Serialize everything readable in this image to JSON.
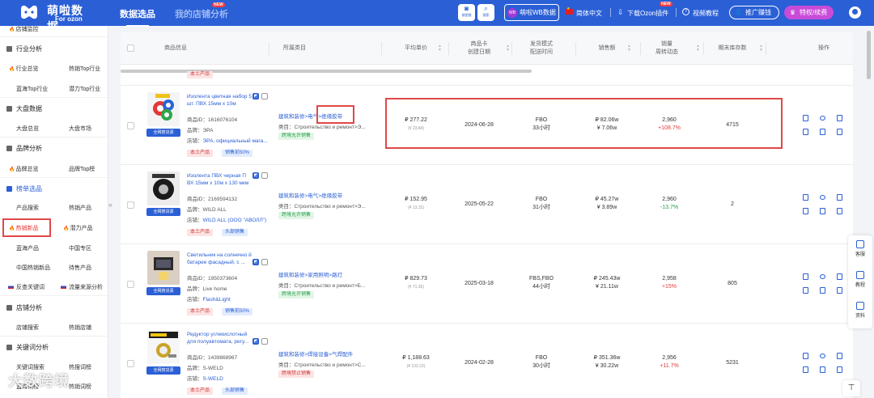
{
  "brand": {
    "name": "萌啦数据",
    "sub": "For ozon"
  },
  "nav": {
    "tab_selection": "数据选品",
    "tab_store": "我的店铺分析",
    "store_badge": "NEW"
  },
  "topbar": {
    "screenshot_label": "按图搜",
    "search_label": "搜索",
    "wb_label": "萌啦WB数据",
    "wb_icon_text": "WB",
    "language": "简体中文",
    "plugin": "下载Ozon插件",
    "plugin_badge": "NEW",
    "video": "视频教程",
    "promo": "推广赚钱",
    "vip": "特权/续费"
  },
  "sidebar": {
    "store_monitor": "店铺监控",
    "industry": {
      "title": "行业分析",
      "items": [
        "行业总览",
        "热销Top行业",
        "蓝海Top行业",
        "潜力Top行业"
      ]
    },
    "market": {
      "title": "大盘数据",
      "items": [
        "大盘总览",
        "大盘市场"
      ]
    },
    "brand": {
      "title": "品牌分析",
      "items": [
        "品牌总览",
        "品牌Top榜"
      ]
    },
    "ranking": {
      "title": "榜单选品",
      "items": [
        "产品搜索",
        "热销产品",
        "热销新品",
        "潜力产品",
        "蓝海产品",
        "中国专区",
        "中国热销新品",
        "待售产品",
        "反查关键词",
        "流量来源分析"
      ]
    },
    "store": {
      "title": "店铺分析",
      "items": [
        "店铺搜索",
        "热销店铺"
      ]
    },
    "keyword": {
      "title": "关键词分析",
      "items": [
        "关键词搜索",
        "热搜词榜",
        "蓝海词榜",
        "热销词榜"
      ]
    }
  },
  "table": {
    "headers": {
      "info": "商品信息",
      "category": "所属类目",
      "avg_price": "平均单价",
      "card_date_1": "商品卡",
      "card_date_2": "创建日期",
      "ship_1": "发货模式",
      "ship_2": "配送时间",
      "sales_amount": "销售额",
      "volume_1": "销量",
      "volume_2": "周转动态",
      "stock": "期末库存数",
      "ops": "操作"
    },
    "partial_tag": "本土产品",
    "source_button": "全网搜货源",
    "rows": [
      {
        "title": "Изолента цветная набор 5 шт. ПВХ 15мм х 10м",
        "id": "商品ID：1616076104",
        "brand": "品牌：ЭРА",
        "store_prefix": "店铺：",
        "store": "ЭРА, официальный мага...",
        "tag1": "本土产品",
        "tag2": "销售前50%",
        "cat_path": "建筑和装修>电气>绝缘胶带",
        "cat_line": "类目：Строительство и ремонт>Э...",
        "cat_tag": "跨境允许销售",
        "price": "₽ 277.22",
        "price_cny": "(¥ 23.84)",
        "date": "2024-06-28",
        "ship": "FBO",
        "ship_time": "33小时",
        "sales_rub": "₽ 82.06w",
        "sales_cny": "¥ 7.06w",
        "volume": "2,960",
        "volume_change": "+108.7%",
        "stock": "4715"
      },
      {
        "title": "Изолента ПВХ черная П ВХ 15мм х 10м х 130 мкм",
        "id": "商品ID：2169594132",
        "brand": "品牌：WILD ALL",
        "store_prefix": "店铺：",
        "store": "WILD ALL (ООО \"АВОЛЛ\")",
        "tag1": "本土产品",
        "tag2": "头部销售",
        "cat_path": "建筑和装修>电气>绝缘胶带",
        "cat_line": "类目：Строительство и ремонт>Э...",
        "cat_tag": "跨境允许销售",
        "price": "₽ 152.95",
        "price_cny": "(¥ 13.15)",
        "date": "2025-05-22",
        "ship": "FBO",
        "ship_time": "31小时",
        "sales_rub": "₽ 45.27w",
        "sales_cny": "¥ 3.89w",
        "volume": "2,960",
        "volume_change": "-13.7%",
        "stock": "2"
      },
      {
        "title": "Светильник на солнечно й батарее фасадный, с ...",
        "id": "商品ID：1950373604",
        "brand": "品牌：Live home",
        "store_prefix": "店铺：",
        "store": "Flash&Light",
        "tag1": "本土产品",
        "tag2": "销售前50%",
        "cat_path": "建筑和装修>家用照明>路灯",
        "cat_line": "类目：Строительство и ремонт>Б...",
        "cat_tag": "跨境允许销售",
        "price": "₽ 829.73",
        "price_cny": "(¥ 71.36)",
        "date": "2025-03-18",
        "ship": "FBS,FBO",
        "ship_time": "44小时",
        "sales_rub": "₽ 245.43w",
        "sales_cny": "¥ 21.11w",
        "volume": "2,958",
        "volume_change": "+15%",
        "stock": "805"
      },
      {
        "title": "Редуктор углекислотный для полуавтомата, регу...",
        "id": "商品ID：1439868967",
        "brand": "品牌：S-WELD",
        "store_prefix": "店铺：",
        "store": "S-WELD",
        "tag1": "本土产品",
        "tag2": "头部销售",
        "cat_path": "建筑和装修>焊接设备>气焊配件",
        "cat_line": "类目：Строительство и ремонт>С...",
        "cat_tag": "跨境禁止销售",
        "price": "₽ 1,188.63",
        "price_cny": "(¥ 102.22)",
        "date": "2024-02-28",
        "ship": "FBO",
        "ship_time": "30小时",
        "sales_rub": "₽ 351.36w",
        "sales_cny": "¥ 30.22w",
        "volume": "2,956",
        "volume_change": "+11.7%",
        "stock": "5231"
      }
    ]
  },
  "float_panel": {
    "service": "客服",
    "tutorial": "教程",
    "material": "资料"
  },
  "watermark": "大数跨境",
  "colors": {
    "primary": "#2a5fd6",
    "highlight": "#e04848",
    "up": "#e03a3a",
    "down": "#26a047"
  }
}
